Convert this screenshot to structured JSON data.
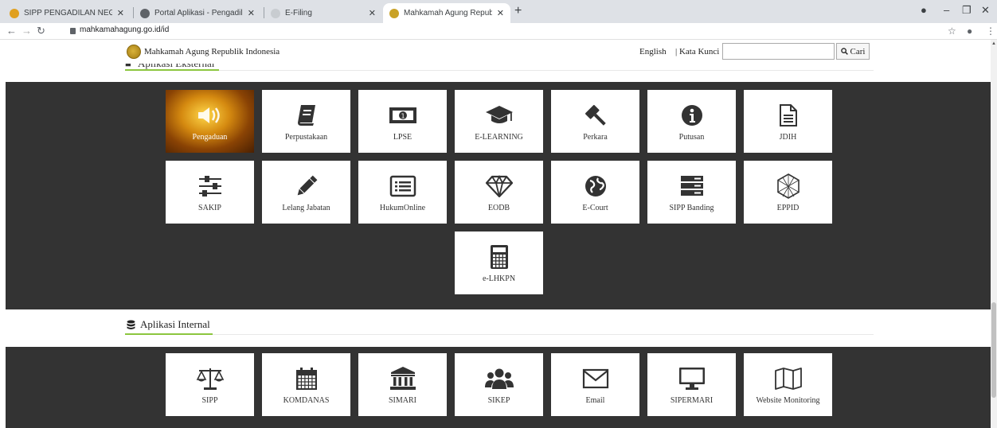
{
  "browser": {
    "tabs": [
      {
        "title": "SIPP PENGADILAN NEGERI BANT",
        "favicon_color": "#e0a020"
      },
      {
        "title": "Portal Aplikasi - Pengadilan Nege",
        "favicon_color": "#5f6368"
      },
      {
        "title": "E-Filing",
        "favicon_color": "#c8ccd0"
      },
      {
        "title": "Mahkamah Agung Republik Indo",
        "favicon_color": "#c9a227"
      }
    ],
    "url": "mahkamahagung.go.id/id"
  },
  "header": {
    "site_title": "Mahkamah Agung Republik Indonesia",
    "lang": "English",
    "kw": "| Kata Kunci",
    "search_value": "",
    "search_button": "Cari"
  },
  "external": {
    "heading": "Aplikasi Eksternal",
    "rows": [
      [
        {
          "label": "Pengaduan",
          "icon": "megaphone"
        },
        {
          "label": "Perpustakaan",
          "icon": "book"
        },
        {
          "label": "LPSE",
          "icon": "money"
        },
        {
          "label": "E-LEARNING",
          "icon": "graduation-cap"
        },
        {
          "label": "Perkara",
          "icon": "gavel"
        },
        {
          "label": "Putusan",
          "icon": "info"
        },
        {
          "label": "JDIH",
          "icon": "file"
        }
      ],
      [
        {
          "label": "SAKIP",
          "icon": "sliders"
        },
        {
          "label": "Lelang Jabatan",
          "icon": "pencil"
        },
        {
          "label": "HukumOnline",
          "icon": "list-alt"
        },
        {
          "label": "EODB",
          "icon": "diamond"
        },
        {
          "label": "E-Court",
          "icon": "globe"
        },
        {
          "label": "SIPP Banding",
          "icon": "server"
        },
        {
          "label": "EPPID",
          "icon": "hexagon-mesh"
        }
      ],
      [
        {
          "label": "e-LHKPN",
          "icon": "calculator"
        }
      ]
    ]
  },
  "internal": {
    "heading": "Aplikasi Internal",
    "items": [
      {
        "label": "SIPP",
        "icon": "balance-scale"
      },
      {
        "label": "KOMDANAS",
        "icon": "calendar"
      },
      {
        "label": "SIMARI",
        "icon": "institution"
      },
      {
        "label": "SIKEP",
        "icon": "users"
      },
      {
        "label": "Email",
        "icon": "envelope"
      },
      {
        "label": "SIPERMARI",
        "icon": "desktop"
      },
      {
        "label": "Website Monitoring",
        "icon": "map"
      }
    ]
  },
  "colors": {
    "dark_band": "#333333",
    "accent_green": "#8cc63f",
    "icon": "#333333"
  }
}
